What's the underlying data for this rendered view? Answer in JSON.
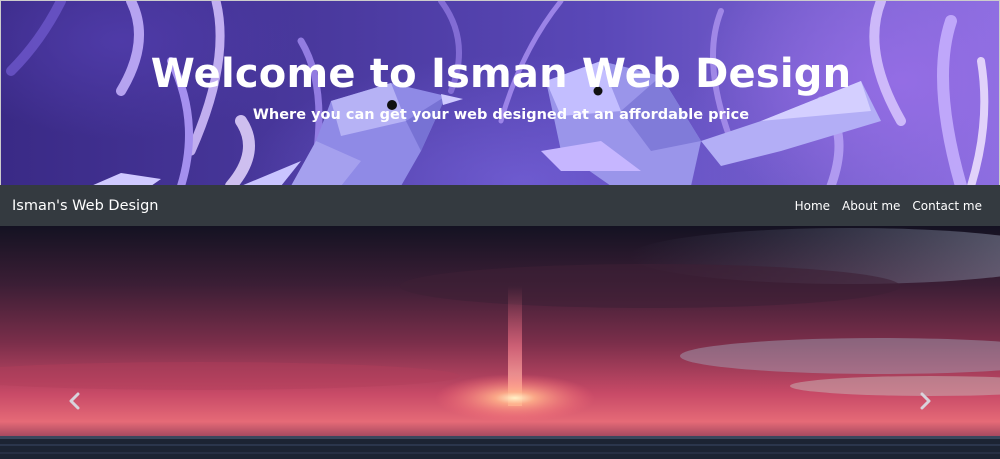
{
  "hero": {
    "title": "Welcome to Isman Web Design",
    "subtitle": "Where you can get your web designed at an affordable price"
  },
  "navbar": {
    "brand": "Isman's Web Design",
    "links": [
      "Home",
      "About me",
      "Contact me"
    ],
    "background": "#343a40"
  },
  "carousel": {
    "prev_icon": "chevron-left-icon",
    "next_icon": "chevron-right-icon"
  }
}
